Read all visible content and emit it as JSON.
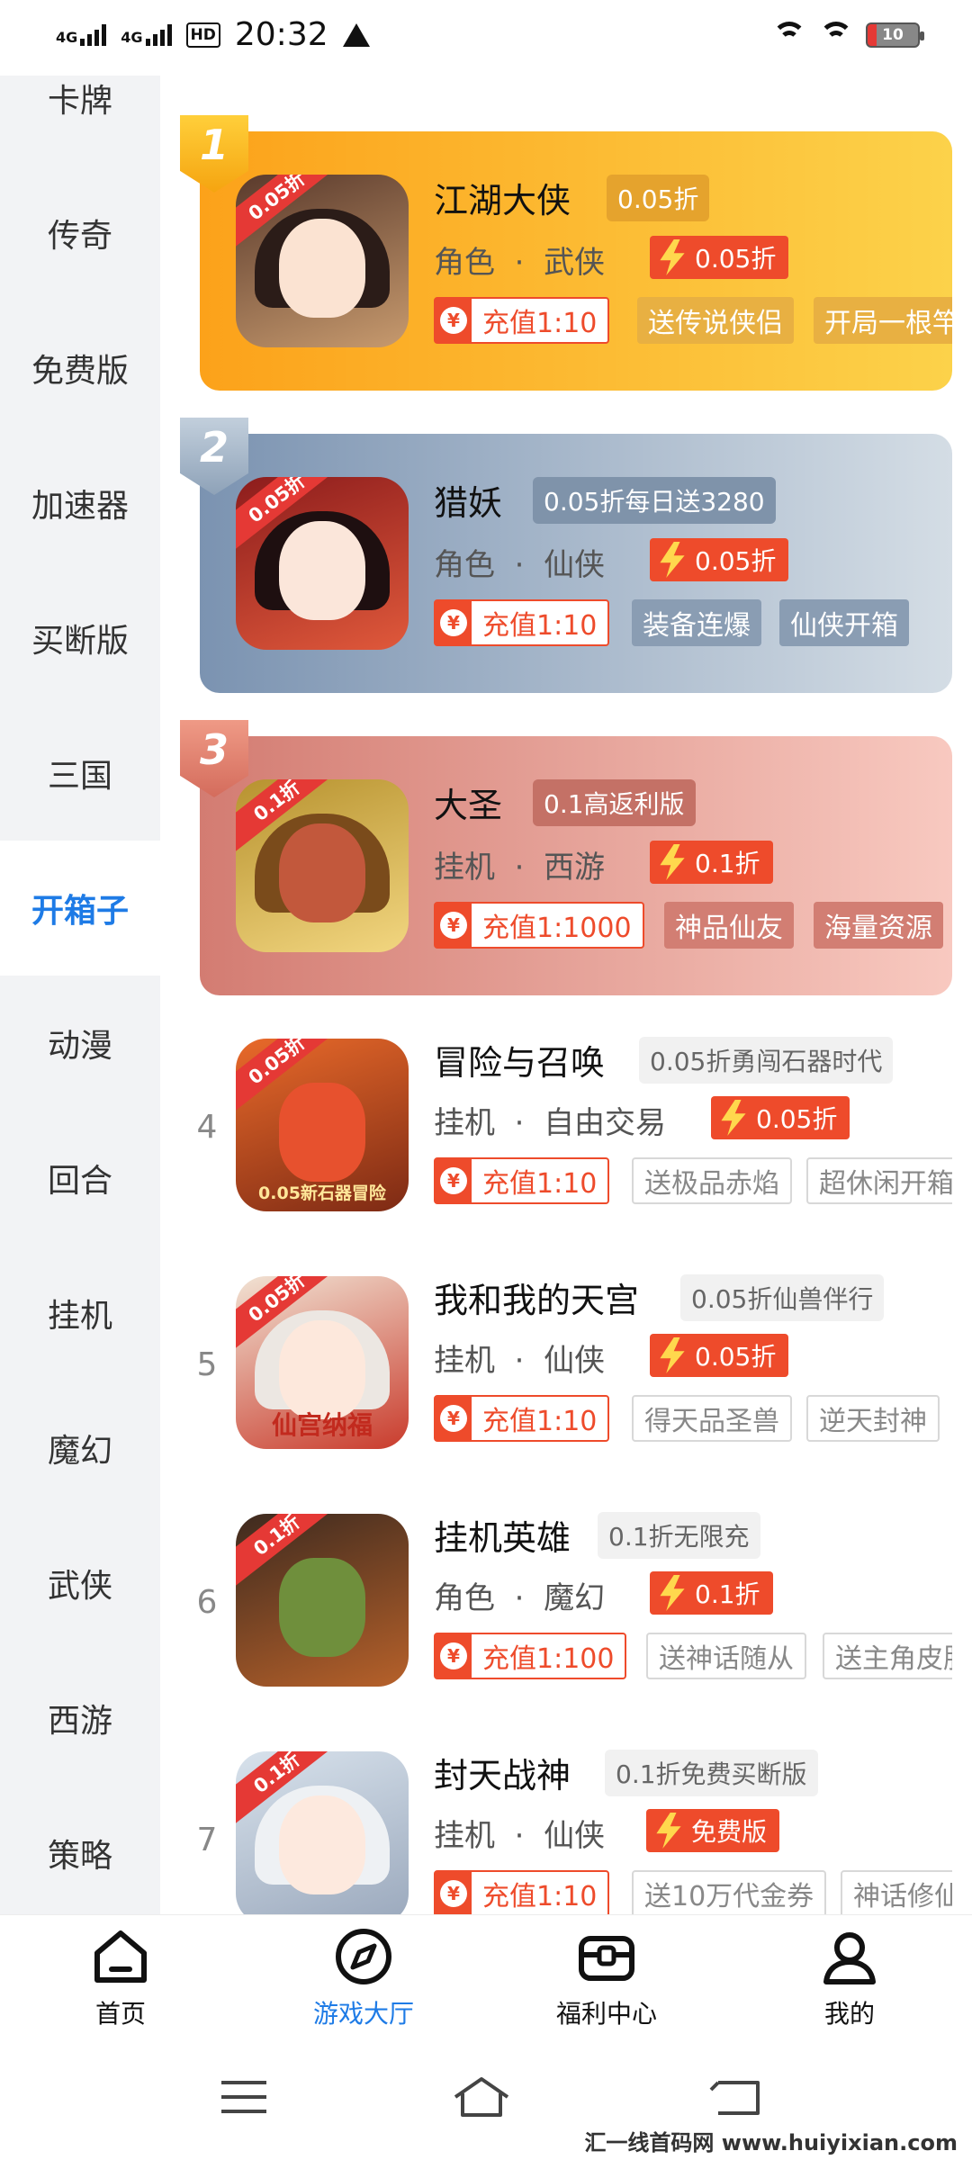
{
  "status_bar": {
    "network_1": "4G",
    "network_2": "4G",
    "hd_label": "HD",
    "time": "20:32",
    "battery": "10"
  },
  "sidebar": {
    "items": [
      {
        "label": "卡牌"
      },
      {
        "label": "传奇"
      },
      {
        "label": "免费版"
      },
      {
        "label": "加速器"
      },
      {
        "label": "买断版"
      },
      {
        "label": "三国"
      },
      {
        "label": "开箱子",
        "active": true
      },
      {
        "label": "动漫"
      },
      {
        "label": "回合"
      },
      {
        "label": "挂机"
      },
      {
        "label": "魔幻"
      },
      {
        "label": "武侠"
      },
      {
        "label": "西游"
      },
      {
        "label": "策略"
      }
    ]
  },
  "games": [
    {
      "rank": "1",
      "name": "江湖大侠",
      "subtitle": "0.05折",
      "genre": "角色",
      "theme": "武侠",
      "discount": "0.05折",
      "icon_tag": "0.05折",
      "charge": "充值1:10",
      "gifts": [
        "送传说侠侣",
        "开局一根竿"
      ]
    },
    {
      "rank": "2",
      "name": "猎妖",
      "subtitle": "0.05折每日送3280",
      "genre": "角色",
      "theme": "仙侠",
      "discount": "0.05折",
      "icon_tag": "0.05折",
      "charge": "充值1:10",
      "gifts": [
        "装备连爆",
        "仙侠开箱"
      ]
    },
    {
      "rank": "3",
      "name": "大圣",
      "subtitle": "0.1高返利版",
      "genre": "挂机",
      "theme": "西游",
      "discount": "0.1折",
      "icon_tag": "0.1折",
      "charge": "充值1:1000",
      "gifts": [
        "神品仙友",
        "海量资源"
      ]
    },
    {
      "rank": "4",
      "name": "冒险与召唤",
      "subtitle": "0.05折勇闯石器时代",
      "genre": "挂机",
      "theme": "自由交易",
      "discount": "0.05折",
      "icon_tag": "0.05折",
      "icon_caption": "0.05新石器冒险",
      "charge": "充值1:10",
      "gifts": [
        "送极品赤焰",
        "超休闲开箱"
      ]
    },
    {
      "rank": "5",
      "name": "我和我的天宫",
      "subtitle": "0.05折仙兽伴行",
      "genre": "挂机",
      "theme": "仙侠",
      "discount": "0.05折",
      "icon_tag": "0.05折",
      "icon_caption": "仙宫纳福",
      "charge": "充值1:10",
      "gifts": [
        "得天品圣兽",
        "逆天封神"
      ]
    },
    {
      "rank": "6",
      "name": "挂机英雄",
      "subtitle": "0.1折无限充",
      "genre": "角色",
      "theme": "魔幻",
      "discount": "0.1折",
      "icon_tag": "0.1折",
      "charge": "充值1:100",
      "gifts": [
        "送神话随从",
        "送主角皮肤"
      ]
    },
    {
      "rank": "7",
      "name": "封天战神",
      "subtitle": "0.1折免费买断版",
      "genre": "挂机",
      "theme": "仙侠",
      "discount": "免费版",
      "icon_tag": "0.1折",
      "charge": "充值1:10",
      "gifts": [
        "送10万代金券",
        "神话修仙"
      ]
    }
  ],
  "meta_separator": "·",
  "yen_symbol": "¥",
  "tabbar": {
    "items": [
      {
        "label": "首页",
        "icon": "home-icon"
      },
      {
        "label": "游戏大厅",
        "icon": "compass-icon",
        "active": true
      },
      {
        "label": "福利中心",
        "icon": "treasure-chest-icon"
      },
      {
        "label": "我的",
        "icon": "user-icon"
      }
    ]
  },
  "watermark": "汇一线首码网 www.huiyixian.com",
  "colors": {
    "accent": "#1e7be6",
    "red": "#ee4b2b",
    "rank1_card": "#fbbd2c",
    "rank2_card": "#a9b8c8",
    "rank3_card": "#e69a92"
  }
}
